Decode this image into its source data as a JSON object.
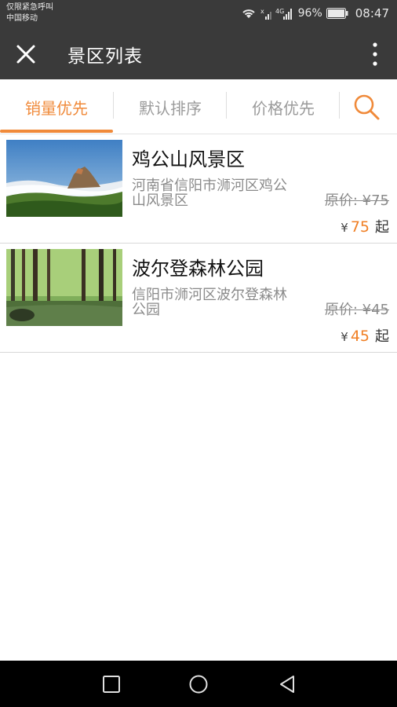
{
  "status_bar": {
    "line1": "仅限紧急呼叫",
    "line2": "中国移动",
    "network": "4G",
    "battery": "96%",
    "time": "08:47"
  },
  "nav": {
    "title": "景区列表",
    "close_icon": "close-icon",
    "more_icon": "more-vertical-icon"
  },
  "tabs": [
    {
      "label": "销量优先",
      "active": true
    },
    {
      "label": "默认排序",
      "active": false
    },
    {
      "label": "价格优先",
      "active": false
    }
  ],
  "search_icon": "search-icon",
  "accent_color": "#f08a3a",
  "items": [
    {
      "title": "鸡公山风景区",
      "address": "河南省信阳市浉河区鸡公山风景区",
      "original_price": "原价: ¥75",
      "currency": "¥",
      "price": "75",
      "price_suffix": "起"
    },
    {
      "title": "波尔登森林公园",
      "address": "信阳市浉河区波尔登森林公园",
      "original_price": "原价: ¥45",
      "currency": "¥",
      "price": "45",
      "price_suffix": "起"
    }
  ],
  "system_nav": [
    "recent-apps-icon",
    "home-icon",
    "back-icon"
  ]
}
